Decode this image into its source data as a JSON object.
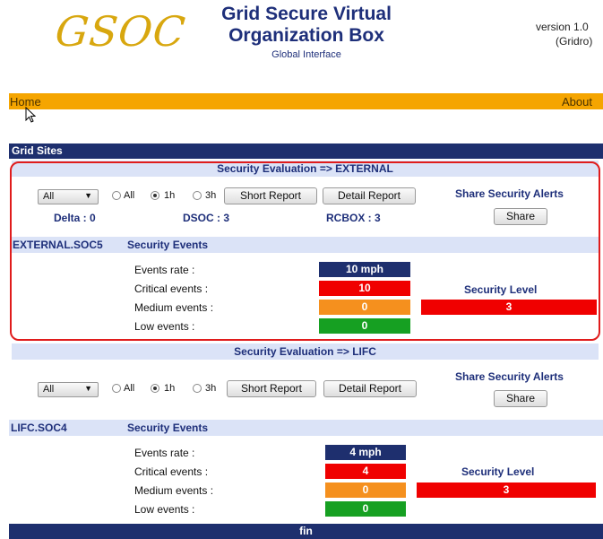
{
  "header": {
    "logo_text": "GSOC",
    "title_line1": "Grid Secure Virtual",
    "title_line2": "Organization Box",
    "subtitle": "Global Interface",
    "version_line1": "version 1.0",
    "version_line2": "(Gridro)"
  },
  "nav": {
    "home": "Home",
    "about": "About"
  },
  "grid_sites_label": "Grid Sites",
  "footer": "fin",
  "sections": [
    {
      "title": "Security Evaluation => EXTERNAL",
      "select_value": "All",
      "radio_options": [
        "All",
        "1h",
        "3h"
      ],
      "radio_selected": "1h",
      "short_report": "Short Report",
      "detail_report": "Detail Report",
      "share_title": "Share Security Alerts",
      "share_button": "Share",
      "stats": {
        "delta": "Delta : 0",
        "dsoc": "DSOC : 3",
        "rcbox": "RCBOX : 3"
      },
      "site_name": "EXTERNAL.SOC5",
      "events_header": "Security Events",
      "labels": {
        "rate": "Events rate :",
        "critical": "Critical events :",
        "medium": "Medium events :",
        "low": "Low events :"
      },
      "values": {
        "rate": "10 mph",
        "critical": "10",
        "medium": "0",
        "low": "0"
      },
      "security_level_label": "Security Level",
      "security_level_value": "3"
    },
    {
      "title": "Security Evaluation => LIFC",
      "select_value": "All",
      "radio_options": [
        "All",
        "1h",
        "3h"
      ],
      "radio_selected": "1h",
      "short_report": "Short Report",
      "detail_report": "Detail Report",
      "share_title": "Share Security Alerts",
      "share_button": "Share",
      "site_name": "LIFC.SOC4",
      "events_header": "Security Events",
      "labels": {
        "rate": "Events rate :",
        "critical": "Critical events :",
        "medium": "Medium events :",
        "low": "Low events :"
      },
      "values": {
        "rate": "4 mph",
        "critical": "4",
        "medium": "0",
        "low": "0"
      },
      "security_level_label": "Security Level",
      "security_level_value": "3"
    }
  ],
  "colors": {
    "nav": "#f5a500",
    "dark_bar": "#1e2f6e",
    "light_bar": "#dbe3f7",
    "critical": "#f00000",
    "medium": "#f5901e",
    "low": "#16a022",
    "highlight_frame": "#e01c1c"
  }
}
